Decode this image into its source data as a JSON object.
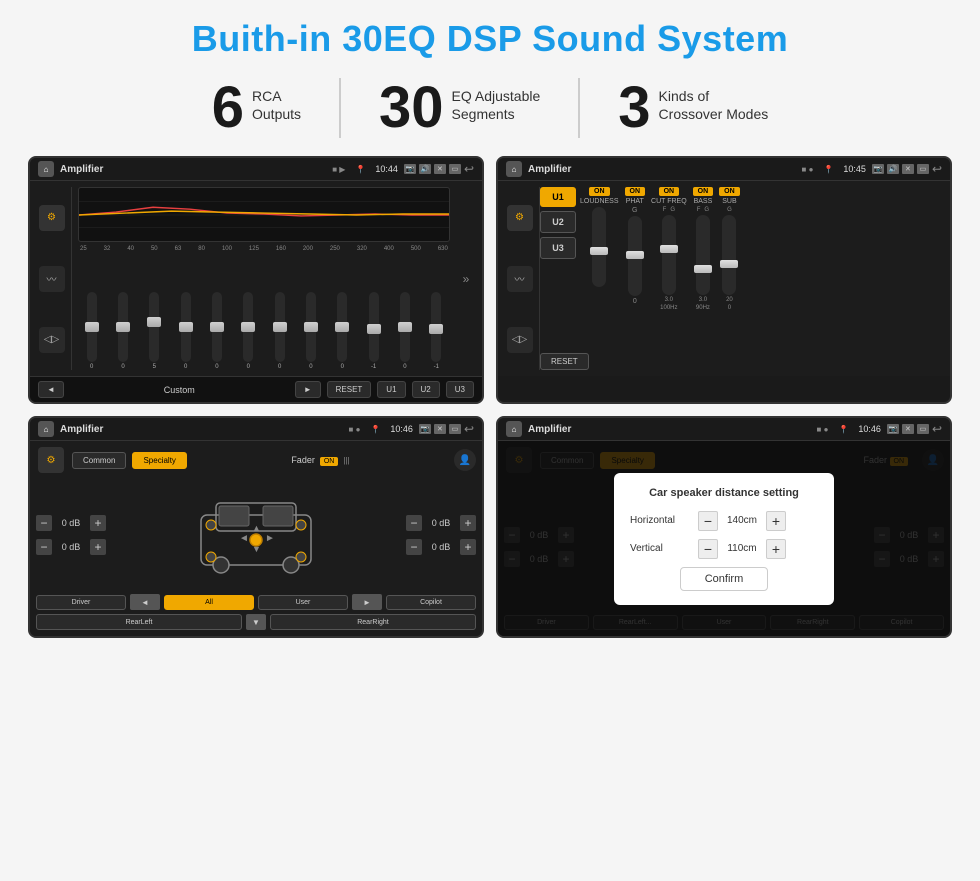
{
  "page": {
    "title": "Buith-in 30EQ DSP Sound System",
    "stats": [
      {
        "number": "6",
        "line1": "RCA",
        "line2": "Outputs"
      },
      {
        "number": "30",
        "line1": "EQ Adjustable",
        "line2": "Segments"
      },
      {
        "number": "3",
        "line1": "Kinds of",
        "line2": "Crossover Modes"
      }
    ]
  },
  "screens": {
    "eq": {
      "title": "Amplifier",
      "time": "10:44",
      "frequencies": [
        "25",
        "32",
        "40",
        "50",
        "63",
        "80",
        "100",
        "125",
        "160",
        "200",
        "250",
        "320",
        "400",
        "500",
        "630"
      ],
      "values": [
        "0",
        "0",
        "0",
        "5",
        "0",
        "0",
        "0",
        "0",
        "0",
        "0",
        "-1",
        "0",
        "-1"
      ],
      "preset": "Custom",
      "buttons": [
        "RESET",
        "U1",
        "U2",
        "U3"
      ]
    },
    "crossover": {
      "title": "Amplifier",
      "time": "10:45",
      "presets": [
        "U1",
        "U2",
        "U3"
      ],
      "controls": [
        "LOUDNESS",
        "PHAT",
        "CUT FREQ",
        "BASS",
        "SUB"
      ],
      "reset": "RESET"
    },
    "fader": {
      "title": "Amplifier",
      "time": "10:46",
      "tabs": [
        "Common",
        "Specialty"
      ],
      "fader_label": "Fader",
      "on_label": "ON",
      "db_values": [
        "0 dB",
        "0 dB",
        "0 dB",
        "0 dB"
      ],
      "bottom_btns": [
        "Driver",
        "RearLeft",
        "All",
        "User",
        "RearRight",
        "Copilot"
      ]
    },
    "distance": {
      "title": "Amplifier",
      "time": "10:46",
      "tabs": [
        "Common",
        "Specialty"
      ],
      "dialog": {
        "title": "Car speaker distance setting",
        "horizontal_label": "Horizontal",
        "horizontal_value": "140cm",
        "vertical_label": "Vertical",
        "vertical_value": "110cm",
        "confirm_label": "Confirm"
      },
      "db_values": [
        "0 dB",
        "0 dB"
      ],
      "bottom_btns": [
        "Driver",
        "RearLeft...",
        "User",
        "RearRight",
        "Copilot"
      ]
    }
  }
}
